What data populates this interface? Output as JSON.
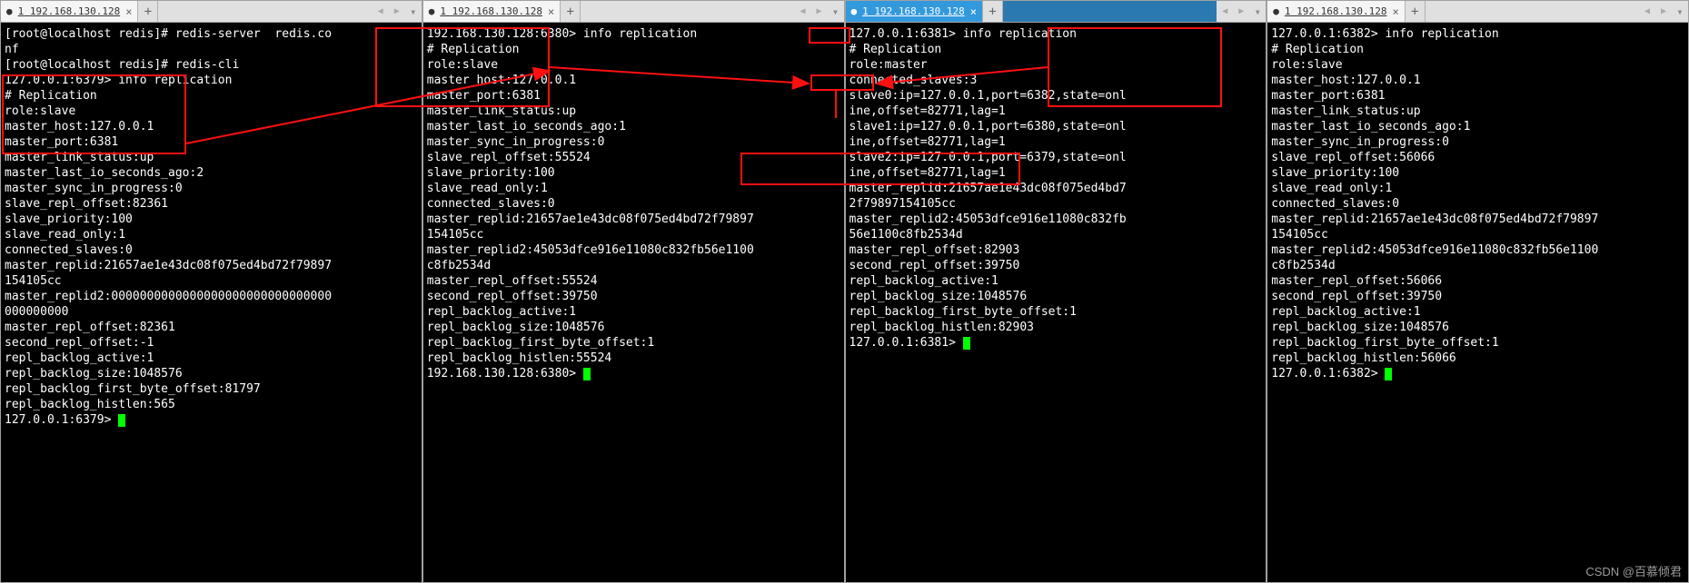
{
  "tabs": {
    "ip": "192.168.130.128",
    "prefix": "1"
  },
  "term1": {
    "lines": [
      "[root@localhost redis]# redis-server  redis.conf",
      "[root@localhost redis]# redis-cli",
      "127.0.0.1:6379> info replication",
      "# Replication",
      "role:slave",
      "master_host:127.0.0.1",
      "master_port:6381",
      "master_link_status:up",
      "master_last_io_seconds_ago:2",
      "master_sync_in_progress:0",
      "slave_repl_offset:82361",
      "slave_priority:100",
      "slave_read_only:1",
      "connected_slaves:0",
      "master_replid:21657ae1e43dc08f075ed4bd72f79897154105cc",
      "master_replid2:0000000000000000000000000000000000000000",
      "master_repl_offset:82361",
      "second_repl_offset:-1",
      "repl_backlog_active:1",
      "repl_backlog_size:1048576",
      "repl_backlog_first_byte_offset:81797",
      "repl_backlog_histlen:565"
    ],
    "prompt": "127.0.0.1:6379> "
  },
  "term2": {
    "lines": [
      "192.168.130.128:6380> info replication",
      "# Replication",
      "role:slave",
      "master_host:127.0.0.1",
      "master_port:6381",
      "master_link_status:up",
      "master_last_io_seconds_ago:1",
      "master_sync_in_progress:0",
      "slave_repl_offset:55524",
      "slave_priority:100",
      "slave_read_only:1",
      "connected_slaves:0",
      "master_replid:21657ae1e43dc08f075ed4bd72f79897154105cc",
      "master_replid2:45053dfce916e11080c832fb56e1100c8fb2534d",
      "master_repl_offset:55524",
      "second_repl_offset:39750",
      "repl_backlog_active:1",
      "repl_backlog_size:1048576",
      "repl_backlog_first_byte_offset:1",
      "repl_backlog_histlen:55524"
    ],
    "prompt": "192.168.130.128:6380> "
  },
  "term3": {
    "lines": [
      "127.0.0.1:6381> info replication",
      "# Replication",
      "role:master",
      "connected_slaves:3",
      "slave0:ip=127.0.0.1,port=6382,state=online,offset=82771,lag=1",
      "slave1:ip=127.0.0.1,port=6380,state=online,offset=82771,lag=1",
      "slave2:ip=127.0.0.1,port=6379,state=online,offset=82771,lag=1",
      "master_replid:21657ae1e43dc08f075ed4bd72f79897154105cc",
      "master_replid2:45053dfce916e11080c832fb56e1100c8fb2534d",
      "master_repl_offset:82903",
      "second_repl_offset:39750",
      "repl_backlog_active:1",
      "repl_backlog_size:1048576",
      "repl_backlog_first_byte_offset:1",
      "repl_backlog_histlen:82903"
    ],
    "prompt": "127.0.0.1:6381> "
  },
  "term4": {
    "lines": [
      "127.0.0.1:6382> info replication",
      "# Replication",
      "role:slave",
      "master_host:127.0.0.1",
      "master_port:6381",
      "master_link_status:up",
      "master_last_io_seconds_ago:1",
      "master_sync_in_progress:0",
      "slave_repl_offset:56066",
      "slave_priority:100",
      "slave_read_only:1",
      "connected_slaves:0",
      "master_replid:21657ae1e43dc08f075ed4bd72f79897154105cc",
      "master_replid2:45053dfce916e11080c832fb56e1100c8fb2534d",
      "master_repl_offset:56066",
      "second_repl_offset:39750",
      "repl_backlog_active:1",
      "repl_backlog_size:1048576",
      "repl_backlog_first_byte_offset:1",
      "repl_backlog_histlen:56066"
    ],
    "prompt": "127.0.0.1:6382> "
  },
  "watermark": "CSDN @百慕倾君"
}
